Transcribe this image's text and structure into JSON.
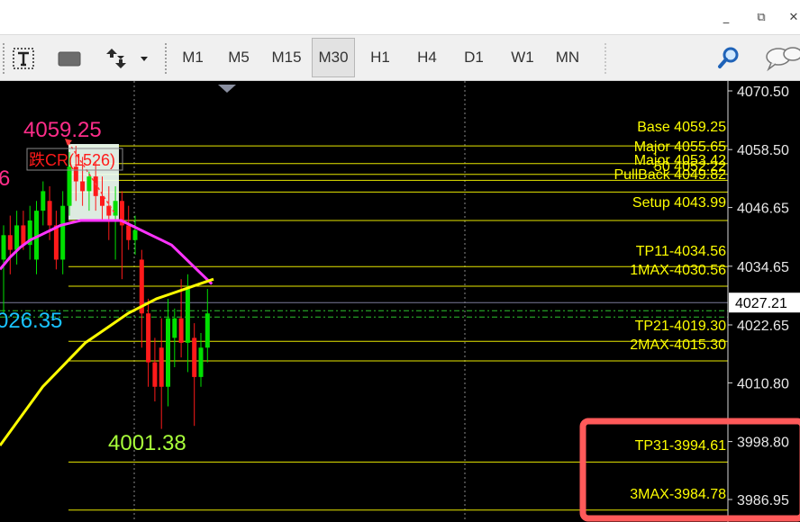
{
  "window": {
    "controls": [
      {
        "name": "minimize-button",
        "glyph": "_"
      },
      {
        "name": "restore-button",
        "glyph": "⧉"
      },
      {
        "name": "close-button",
        "glyph": "✕"
      }
    ]
  },
  "toolbar": {
    "timeframes": [
      "M1",
      "M5",
      "M15",
      "M30",
      "H1",
      "H4",
      "D1",
      "W1",
      "MN"
    ],
    "active_timeframe": "M30"
  },
  "chart": {
    "colors": {
      "background": "#000000",
      "level_line": "#e8e800",
      "level_text": "#ffff00",
      "bull_candle": "#00e000",
      "bear_candle": "#ff1a1a",
      "ma_fast": "#ff33ff",
      "ma_slow": "#ffff00",
      "high_label": "#ff2d8a",
      "low_label": "#a8ff3a",
      "current_label": "#19c3ff",
      "highlight_box": "#ff5a5a"
    },
    "price_axis": {
      "ticks": [
        "4070.50",
        "4058.50",
        "4046.65",
        "4034.65",
        "4022.65",
        "4010.80",
        "3998.80",
        "3986.95"
      ],
      "current_price": "4027.21",
      "range": [
        3984,
        4072
      ]
    },
    "levels": [
      {
        "label": "Base 4059.25",
        "price": 4059.25
      },
      {
        "label": "Major 4055.65",
        "price": 4055.65
      },
      {
        "label": "Major 4053.42",
        "price": 4053.42
      },
      {
        "label": "50 4052.22",
        "price": 4052.22
      },
      {
        "label": "PullBack 4049.82",
        "price": 4049.82
      },
      {
        "label": "Setup 4043.99",
        "price": 4043.99
      },
      {
        "label": "TP11-4034.56",
        "price": 4034.56
      },
      {
        "label": "1MAX-4030.56",
        "price": 4030.56
      },
      {
        "label": "TP21-4019.30",
        "price": 4019.3
      },
      {
        "label": "2MAX-4015.30",
        "price": 4015.3
      },
      {
        "label": "TP31-3994.61",
        "price": 3994.61
      },
      {
        "label": "3MAX-3984.78",
        "price": 3984.78
      }
    ],
    "annotations": {
      "high_value": "4059.25",
      "low_value": "4001.38",
      "current_partial": "026.35",
      "left_partial": "6",
      "cr_label": "跌CR(1526)"
    },
    "candles": [
      {
        "o": 4036,
        "h": 4043,
        "l": 4025,
        "c": 4041
      },
      {
        "o": 4041,
        "h": 4045,
        "l": 4033,
        "c": 4038
      },
      {
        "o": 4038,
        "h": 4046,
        "l": 4035,
        "c": 4043
      },
      {
        "o": 4043,
        "h": 4046,
        "l": 4038,
        "c": 4039
      },
      {
        "o": 4039,
        "h": 4047,
        "l": 4036,
        "c": 4044
      },
      {
        "o": 4036,
        "h": 4048,
        "l": 4033,
        "c": 4046
      },
      {
        "o": 4046,
        "h": 4052,
        "l": 4043,
        "c": 4050
      },
      {
        "o": 4048,
        "h": 4051,
        "l": 4040,
        "c": 4043
      },
      {
        "o": 4043,
        "h": 4046,
        "l": 4034,
        "c": 4036
      },
      {
        "o": 4036,
        "h": 4050,
        "l": 4033,
        "c": 4047
      },
      {
        "o": 4047,
        "h": 4058,
        "l": 4045,
        "c": 4055
      },
      {
        "o": 4055,
        "h": 4059.25,
        "l": 4048,
        "c": 4052
      },
      {
        "o": 4052,
        "h": 4057,
        "l": 4047,
        "c": 4050
      },
      {
        "o": 4050,
        "h": 4054,
        "l": 4046,
        "c": 4053
      },
      {
        "o": 4053,
        "h": 4056,
        "l": 4046,
        "c": 4049
      },
      {
        "o": 4049,
        "h": 4053,
        "l": 4044,
        "c": 4047
      },
      {
        "o": 4047,
        "h": 4051,
        "l": 4040,
        "c": 4045
      },
      {
        "o": 4045,
        "h": 4051,
        "l": 4036,
        "c": 4048
      },
      {
        "o": 4048,
        "h": 4050,
        "l": 4032,
        "c": 4043
      },
      {
        "o": 4043,
        "h": 4047,
        "l": 4038,
        "c": 4040
      },
      {
        "o": 4040,
        "h": 4045,
        "l": 4037,
        "c": 4042
      },
      {
        "o": 4036,
        "h": 4038,
        "l": 4018,
        "c": 4025
      },
      {
        "o": 4025,
        "h": 4028,
        "l": 4010,
        "c": 4015
      },
      {
        "o": 4015,
        "h": 4020,
        "l": 4007,
        "c": 4010
      },
      {
        "o": 4018,
        "h": 4024,
        "l": 4001.38,
        "c": 4010
      },
      {
        "o": 4010,
        "h": 4028,
        "l": 4006,
        "c": 4024
      },
      {
        "o": 4020,
        "h": 4026,
        "l": 4014,
        "c": 4024
      },
      {
        "o": 4024,
        "h": 4032,
        "l": 4016,
        "c": 4019
      },
      {
        "o": 4019,
        "h": 4033,
        "l": 4013,
        "c": 4030
      },
      {
        "o": 4020,
        "h": 4023,
        "l": 4002,
        "c": 4012
      },
      {
        "o": 4012,
        "h": 4021,
        "l": 4010,
        "c": 4018
      },
      {
        "o": 4018,
        "h": 4030,
        "l": 4015,
        "c": 4025
      }
    ],
    "ma_fast": [
      4034,
      4036.5,
      4038.5,
      4040,
      4041,
      4042,
      4043,
      4043.5,
      4044,
      4044,
      4044,
      4044,
      4044,
      4043,
      4042,
      4041,
      4040,
      4039,
      4037,
      4035,
      4033,
      4031
    ],
    "ma_slow": [
      3998,
      4002,
      4006,
      4010,
      4013,
      4016,
      4019,
      4021,
      4023,
      4025,
      4026.5,
      4028,
      4029,
      4030,
      4031,
      4032
    ]
  }
}
